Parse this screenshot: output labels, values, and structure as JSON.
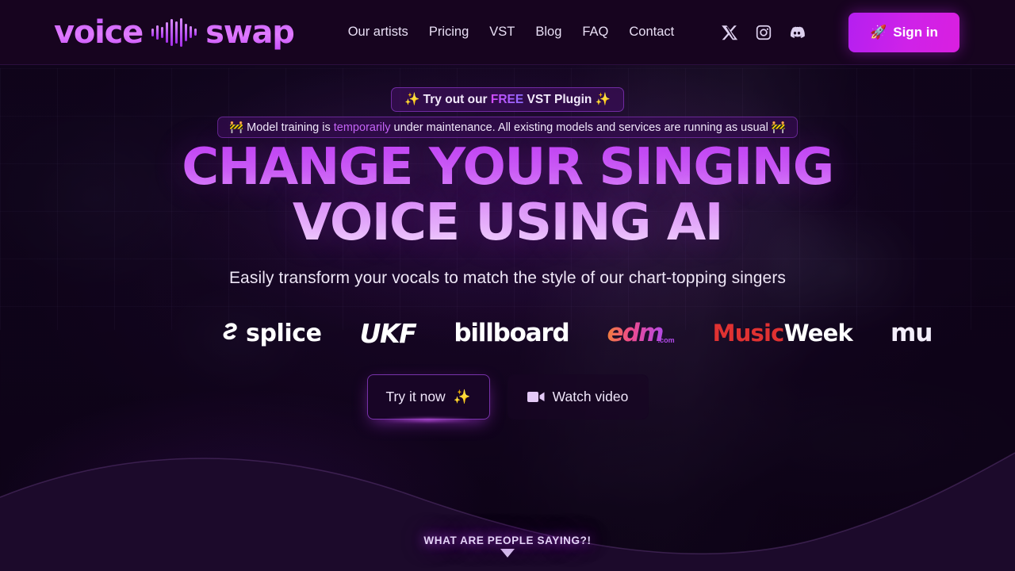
{
  "header": {
    "logo": {
      "word1": "voice",
      "word2": "swap",
      "waveform_icon": "waveform-icon"
    },
    "nav": [
      {
        "label": "Our artists"
      },
      {
        "label": "Pricing"
      },
      {
        "label": "VST"
      },
      {
        "label": "Blog"
      },
      {
        "label": "FAQ"
      },
      {
        "label": "Contact"
      }
    ],
    "social": [
      {
        "name": "x-icon"
      },
      {
        "name": "instagram-icon"
      },
      {
        "name": "discord-icon"
      }
    ],
    "signin": {
      "label": "Sign in",
      "icon": "rocket-icon",
      "emoji": "🚀"
    }
  },
  "banners": {
    "vst": {
      "sparkle_left": "✨",
      "text_before": "Try out our ",
      "highlight": "FREE",
      "text_after": " VST Plugin ",
      "sparkle_right": "✨"
    },
    "maintenance": {
      "emoji_left": "🚧",
      "text_before": "Model training is ",
      "highlight": "temporarily",
      "text_after": " under maintenance. All existing models and services are running as usual ",
      "emoji_right": "🚧"
    }
  },
  "hero": {
    "headline_line1": "CHANGE YOUR SINGING",
    "headline_line2": "VOICE USING AI",
    "subtitle": "Easily transform your vocals to match the style of our chart-topping singers",
    "cta_primary": {
      "label": "Try it now",
      "sparkle": "✨"
    },
    "cta_secondary": {
      "label": "Watch video",
      "icon": "video-camera-icon"
    }
  },
  "partner_logos": [
    {
      "name": "splice-logo",
      "text": "splice"
    },
    {
      "name": "ukf-logo",
      "text": "UKF"
    },
    {
      "name": "billboard-logo",
      "text": "billboard"
    },
    {
      "name": "edm-logo",
      "text": "edm",
      "suffix": ".com"
    },
    {
      "name": "musicweek-logo",
      "text1": "Music",
      "text2": "Week"
    },
    {
      "name": "mu-logo",
      "text": "mu"
    }
  ],
  "scroll_prompt": {
    "label": "WHAT ARE PEOPLE SAYING?!",
    "arrow": "down-arrow-icon"
  },
  "colors": {
    "accent": "#c242f5",
    "accent_bright": "#d91fe0",
    "bg": "#150320",
    "header_bg": "#17041f",
    "text": "#efe6f7",
    "red": "#e03232"
  }
}
